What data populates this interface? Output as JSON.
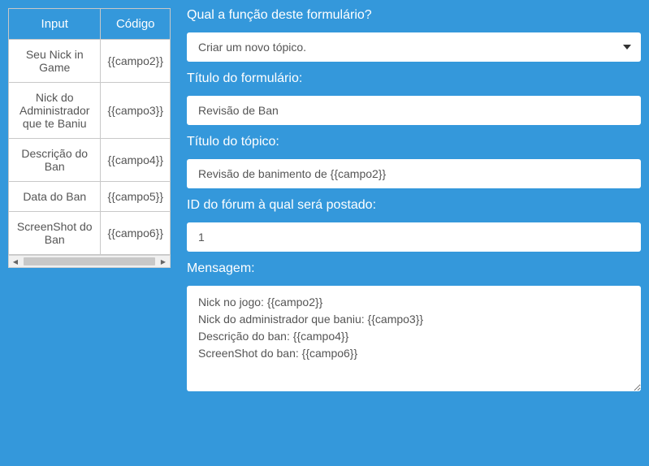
{
  "table": {
    "headers": [
      "Input",
      "Código"
    ],
    "rows": [
      [
        "Seu Nick in Game",
        "{{campo2}}"
      ],
      [
        "Nick do Administrador que te Baniu",
        "{{campo3}}"
      ],
      [
        "Descrição do Ban",
        "{{campo4}}"
      ],
      [
        "Data do Ban",
        "{{campo5}}"
      ],
      [
        "ScreenShot do Ban",
        "{{campo6}}"
      ]
    ]
  },
  "form": {
    "function_label": "Qual a função deste formulário?",
    "function_value": "Criar um novo tópico.",
    "title_label": "Título do formulário:",
    "title_value": "Revisão de Ban",
    "topic_title_label": "Título do tópico:",
    "topic_title_value": "Revisão de banimento de {{campo2}}",
    "forum_id_label": "ID do fórum à qual será postado:",
    "forum_id_value": "1",
    "message_label": "Mensagem:",
    "message_value": "Nick no jogo: {{campo2}}\nNick do administrador que baniu: {{campo3}}\nDescrição do ban: {{campo4}}\nScreenShot do ban: {{campo6}}"
  }
}
